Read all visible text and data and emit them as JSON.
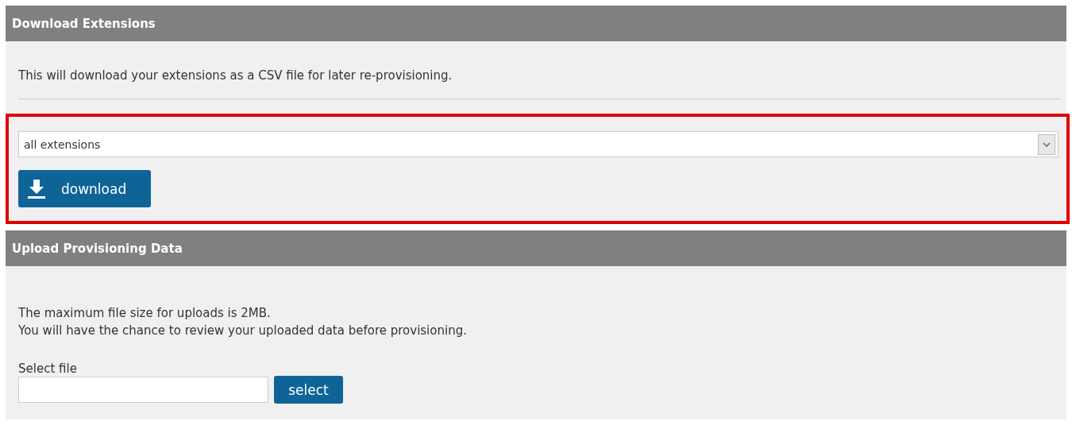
{
  "download_section": {
    "title": "Download Extensions",
    "description": "This will download your extensions as a CSV file for later re-provisioning.",
    "highlighted": true,
    "dropdown": {
      "value": "all extensions"
    },
    "button": {
      "label": "download"
    }
  },
  "upload_section": {
    "title": "Upload Provisioning Data",
    "lines": [
      "The maximum file size for uploads is 2MB.",
      "You will have the chance to review your uploaded data before provisioning."
    ],
    "file_label": "Select file",
    "button": {
      "label": "select"
    }
  }
}
